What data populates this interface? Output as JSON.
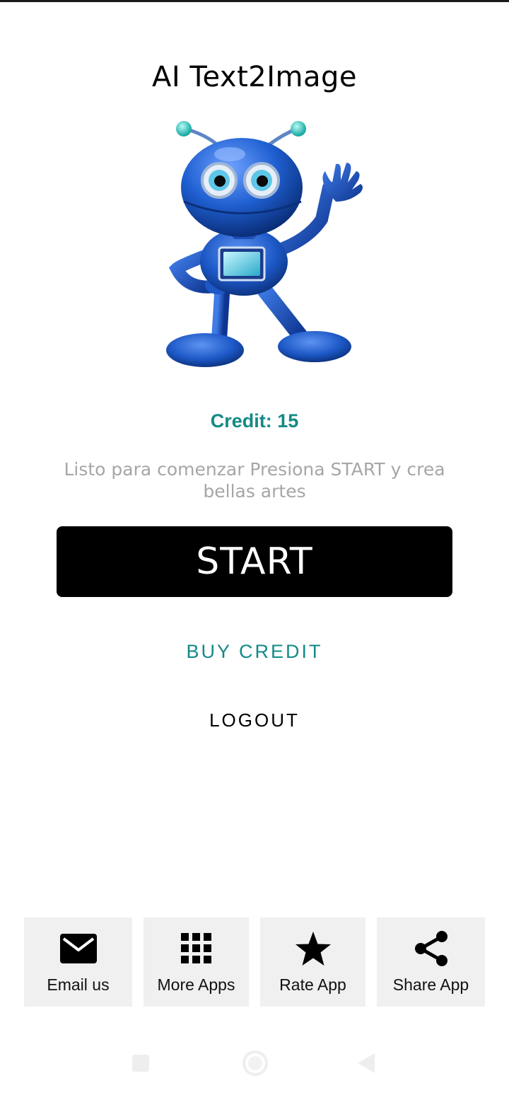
{
  "app": {
    "title": "AI Text2Image"
  },
  "main": {
    "credit_text": "Credit: 15",
    "status_text": "Listo para comenzar Presiona START y crea bellas artes",
    "start_label": "START",
    "buy_credit_label": "BUY CREDIT",
    "logout_label": "LOGOUT"
  },
  "bottom_actions": [
    {
      "label": "Email us",
      "icon": "mail-icon"
    },
    {
      "label": "More Apps",
      "icon": "grid-icon"
    },
    {
      "label": "Rate App",
      "icon": "star-icon"
    },
    {
      "label": "Share App",
      "icon": "share-icon"
    }
  ],
  "colors": {
    "accent": "#138a86",
    "button_bg": "#000000",
    "muted_text": "#a6a6a6",
    "tile_bg": "#f0f0f0",
    "robot_blue": "#1f5fd1"
  },
  "system_nav": [
    "recents-button",
    "home-button",
    "back-button"
  ]
}
